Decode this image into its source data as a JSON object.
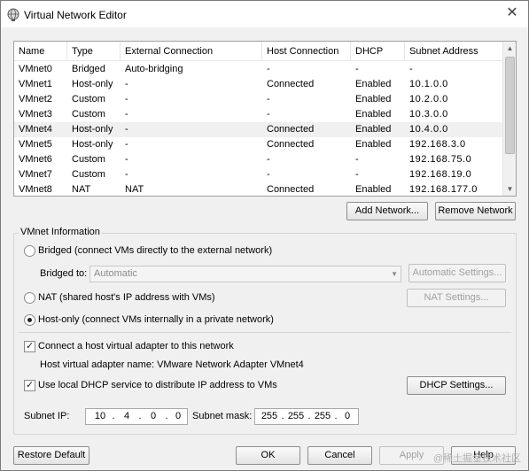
{
  "window": {
    "title": "Virtual Network Editor",
    "close_label": "✕"
  },
  "network_list": {
    "columns": [
      "Name",
      "Type",
      "External Connection",
      "Host Connection",
      "DHCP",
      "Subnet Address"
    ],
    "rows": [
      {
        "name": "VMnet0",
        "type": "Bridged",
        "external": "Auto-bridging",
        "host": "-",
        "dhcp": "-",
        "subnet": "-"
      },
      {
        "name": "VMnet1",
        "type": "Host-only",
        "external": "-",
        "host": "Connected",
        "dhcp": "Enabled",
        "subnet": "10.1.0.0"
      },
      {
        "name": "VMnet2",
        "type": "Custom",
        "external": "-",
        "host": "-",
        "dhcp": "Enabled",
        "subnet": "10.2.0.0"
      },
      {
        "name": "VMnet3",
        "type": "Custom",
        "external": "-",
        "host": "-",
        "dhcp": "Enabled",
        "subnet": "10.3.0.0"
      },
      {
        "name": "VMnet4",
        "type": "Host-only",
        "external": "-",
        "host": "Connected",
        "dhcp": "Enabled",
        "subnet": "10.4.0.0"
      },
      {
        "name": "VMnet5",
        "type": "Host-only",
        "external": "-",
        "host": "Connected",
        "dhcp": "Enabled",
        "subnet": "192.168.3.0"
      },
      {
        "name": "VMnet6",
        "type": "Custom",
        "external": "-",
        "host": "-",
        "dhcp": "-",
        "subnet": "192.168.75.0"
      },
      {
        "name": "VMnet7",
        "type": "Custom",
        "external": "-",
        "host": "-",
        "dhcp": "-",
        "subnet": "192.168.19.0"
      },
      {
        "name": "VMnet8",
        "type": "NAT",
        "external": "NAT",
        "host": "Connected",
        "dhcp": "Enabled",
        "subnet": "192.168.177.0"
      }
    ],
    "selected_index": 4
  },
  "list_buttons": {
    "add_network": "Add Network...",
    "remove_network": "Remove Network"
  },
  "vmnet_info": {
    "group_label": "VMnet Information",
    "bridged_label": "Bridged (connect VMs directly to the external network)",
    "bridged_to_label": "Bridged to:",
    "bridged_to_value": "Automatic",
    "automatic_settings": "Automatic Settings...",
    "nat_label": "NAT (shared host's IP address with VMs)",
    "nat_settings": "NAT Settings...",
    "hostonly_label": "Host-only (connect VMs internally in a private network)",
    "connect_adapter_label": "Connect a host virtual adapter to this network",
    "adapter_name_label": "Host virtual adapter name: VMware Network Adapter VMnet4",
    "dhcp_label": "Use local DHCP service to distribute IP address to VMs",
    "dhcp_settings": "DHCP Settings...",
    "selected_mode": "host-only",
    "connect_adapter_checked": true,
    "dhcp_checked": true,
    "subnet_ip_label": "Subnet IP:",
    "subnet_ip": [
      "10",
      "4",
      "0",
      "0"
    ],
    "subnet_mask_label": "Subnet mask:",
    "subnet_mask": [
      "255",
      "255",
      "255",
      "0"
    ]
  },
  "footer": {
    "restore_default": "Restore Default",
    "ok": "OK",
    "cancel": "Cancel",
    "apply": "Apply",
    "help": "Help",
    "watermark": "@稀土掘金技术社区"
  }
}
